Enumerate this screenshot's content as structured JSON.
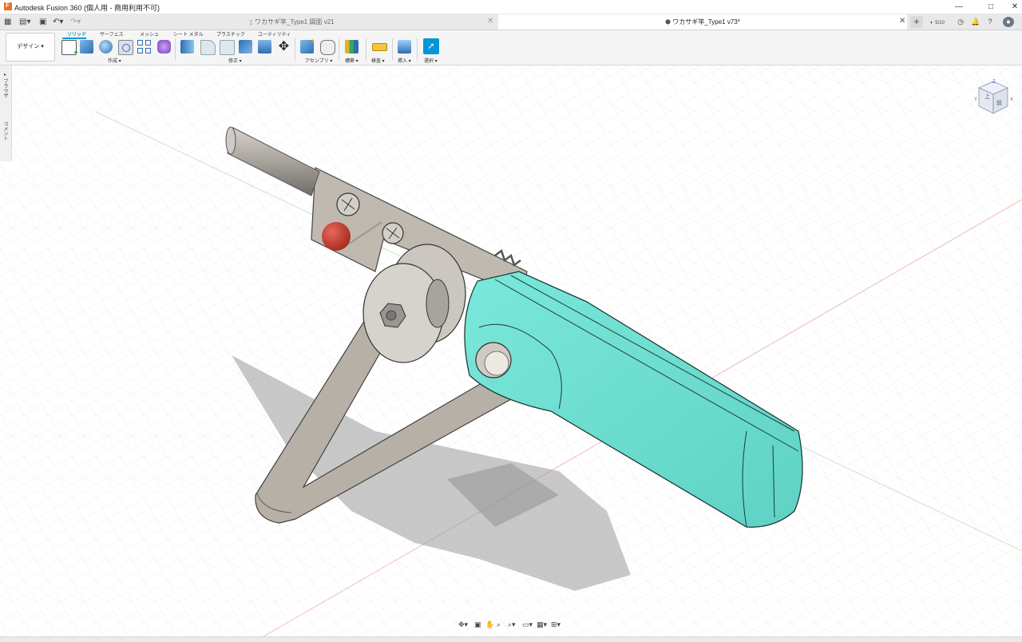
{
  "window": {
    "title": "Autodesk Fusion 360 (個人用 - 商用利用不可)",
    "controls": [
      "—",
      "□",
      "✕"
    ]
  },
  "tabs": {
    "quick_access": [
      "grid-icon",
      "file-icon",
      "save-icon",
      "undo-icon",
      "redo-icon"
    ],
    "documents": [
      {
        "label": "ワカサギ竿_Type1 図面 v21",
        "active": false
      },
      {
        "label": "ワカサギ竿_Type1 v73*",
        "active": true
      }
    ],
    "close_glyph": "✕",
    "job_status": "5/10"
  },
  "toolbar": {
    "workspace": "デザイン ▾",
    "tabs": [
      "ソリッド",
      "サーフェス",
      "メッシュ",
      "シート メタル",
      "プラスチック",
      "ユーティリティ"
    ],
    "groups": [
      "作成 ▾",
      "修正 ▾",
      "アセンブリ ▾",
      "構築 ▾",
      "検査 ▾",
      "挿入 ▾",
      "選択 ▾"
    ],
    "accent_color": "#0696d7"
  },
  "browser": {
    "labels": [
      "▸ ブラウザ",
      "コメント"
    ]
  },
  "viewcube": {
    "faces": [
      "上",
      "前"
    ],
    "axes": [
      "X",
      "Y",
      "Z"
    ]
  },
  "navbar": {
    "tools": [
      "orbit-icon",
      "look-icon",
      "pan-icon",
      "zoom-icon",
      "fit-icon",
      "display-icon",
      "grid-icon",
      "viewports-icon"
    ]
  },
  "model": {
    "handle_color": "#6ee0d2",
    "frame_color": "#b7b0a6",
    "ball_color": "#c0392b"
  }
}
